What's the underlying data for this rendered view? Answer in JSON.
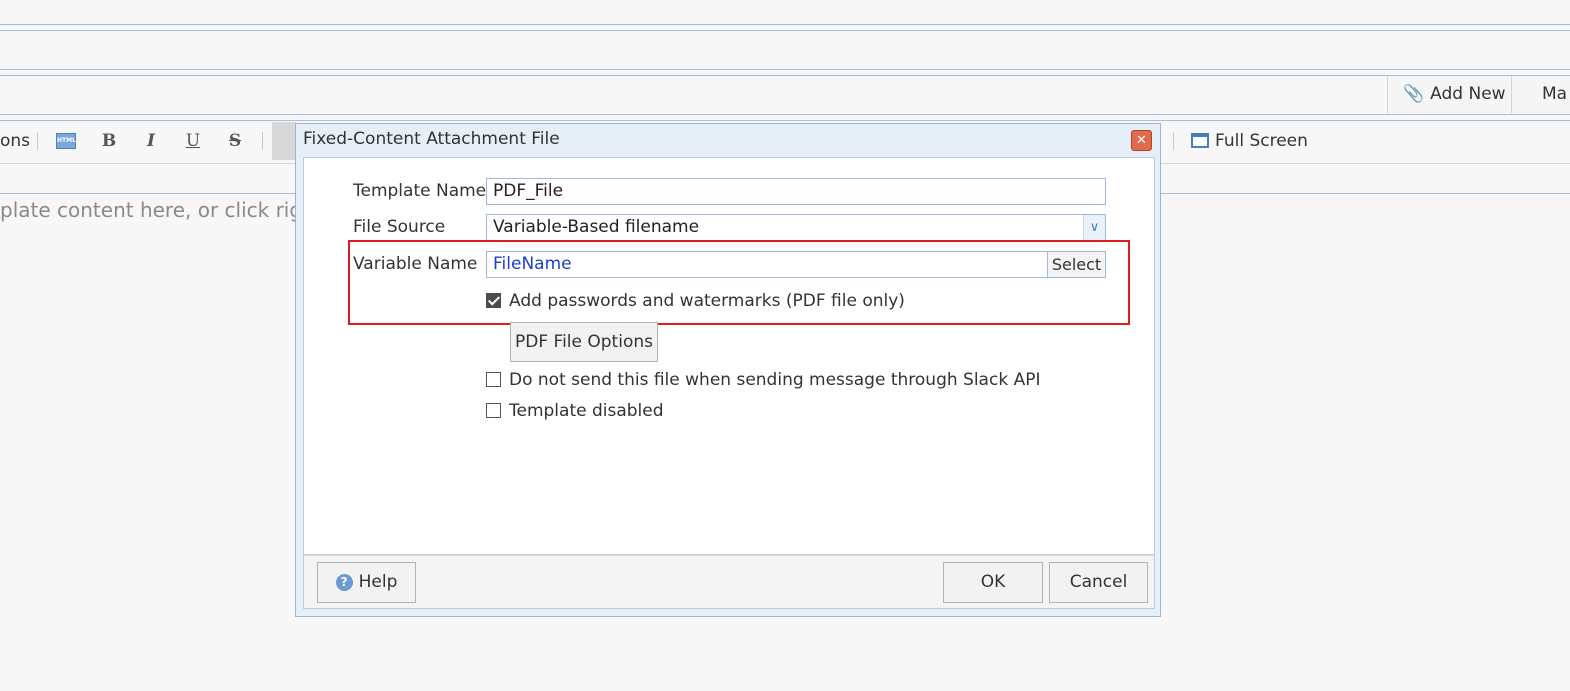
{
  "header": {
    "add_new_label": "Add New",
    "add_new_icon": "paperclip-icon",
    "next_button_label": "Ma"
  },
  "toolbar": {
    "options_label": "ons",
    "html_icon_text": "HTML",
    "bold": "B",
    "italic": "I",
    "underline": "U",
    "strike": "S",
    "full_screen_label": "Full Screen"
  },
  "editor": {
    "placeholder": "plate content here, or click righ"
  },
  "dialog": {
    "title": "Fixed-Content Attachment File",
    "close_glyph": "✕",
    "template_name_label": "Template Name",
    "template_name_value": "PDF_File",
    "file_source_label": "File Source",
    "file_source_value": "Variable-Based filename",
    "variable_name_label": "Variable Name",
    "variable_name_value": "FileName",
    "select_button_label": "Select",
    "add_passwords_label": "Add passwords and watermarks (PDF file only)",
    "add_passwords_checked": true,
    "pdf_options_button_label": "PDF File Options",
    "no_slack_label": "Do not send this file when sending message through Slack API",
    "no_slack_checked": false,
    "template_disabled_label": "Template disabled",
    "template_disabled_checked": false,
    "help_button_label": "Help",
    "ok_button_label": "OK",
    "cancel_button_label": "Cancel"
  },
  "colors": {
    "highlight_border": "#e11b22",
    "variable_text": "#1a3fcf",
    "dialog_frame": "#e6eef8"
  }
}
